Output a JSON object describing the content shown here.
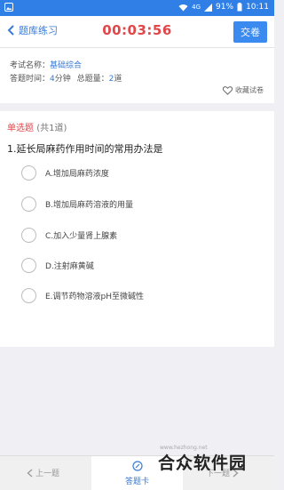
{
  "status_bar": {
    "signal_text": "4G",
    "battery": "91%",
    "time": "10:11"
  },
  "header": {
    "back_label": "题库练习",
    "timer": "00:03:56",
    "submit_label": "交卷"
  },
  "exam_info": {
    "name_label": "考试名称：",
    "name_value": "基础综合",
    "time_label": "答题时间：",
    "time_value": "4",
    "time_unit": "分钟",
    "total_label": "总题量：",
    "total_value": "2",
    "total_unit": "道",
    "favorite_label": "收藏试卷"
  },
  "question": {
    "type_label": "单选题",
    "type_count": "(共1道)",
    "text": "1.延长局麻药作用时间的常用办法是",
    "options": [
      "A.增加局麻药浓度",
      "B.增加局麻药溶液的用量",
      "C.加入少量肾上腺素",
      "D.注射麻黄碱",
      "E.调节药物溶液pH至微碱性"
    ]
  },
  "bottom_nav": {
    "prev_label": "上一题",
    "card_label": "答题卡",
    "next_label": "下一题"
  },
  "watermark": {
    "text": "合众软件园",
    "url": "www.hezhong.net"
  },
  "colors": {
    "status_bar": "#2f7fe6",
    "accent": "#3a7bd5",
    "timer": "#e0474b",
    "submit_button": "#3a8af0"
  }
}
